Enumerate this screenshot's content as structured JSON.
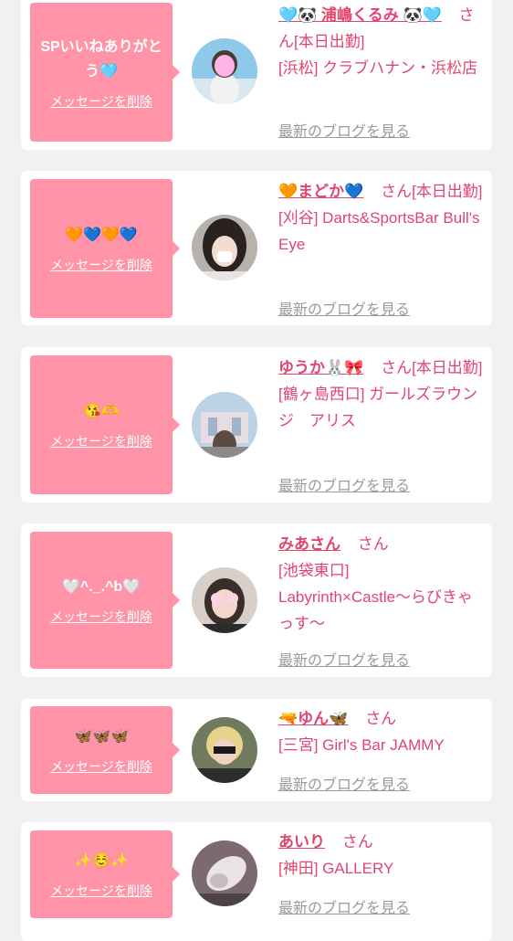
{
  "messages": [
    {
      "message": "SPいいねありがとう🩵",
      "delete_label": "メッセージを削除",
      "name": "🩵🐼 浦嶋くるみ 🐼🩵",
      "san": "さん",
      "status": "[本日出勤]",
      "shop": "[浜松] クラブハナン・浜松店",
      "blog_label": "最新のブログを見る"
    },
    {
      "message": "🧡💙🧡💙",
      "delete_label": "メッセージを削除",
      "name": "🧡まどか💙",
      "san": "さん",
      "status": "[本日出勤]",
      "shop": "[刈谷] Darts&SportsBar Bull's Eye",
      "blog_label": "最新のブログを見る"
    },
    {
      "message": "😘🫶",
      "delete_label": "メッセージを削除",
      "name": "ゆうか🐰🎀",
      "san": "さん",
      "status": "[本日出勤]",
      "shop": "[鶴ヶ島西口] ガールズラウンジ　アリス",
      "blog_label": "最新のブログを見る"
    },
    {
      "message": "🤍^._.^b🤍",
      "delete_label": "メッセージを削除",
      "name": "みあさん",
      "san": "さん",
      "status": "",
      "shop": "[池袋東口] Labyrinth×Castle〜らびきゃっす〜",
      "blog_label": "最新のブログを見る"
    },
    {
      "message": "🦋🦋🦋",
      "delete_label": "メッセージを削除",
      "name": "🔫ゆん🦋",
      "san": "さん",
      "status": "",
      "shop": "[三宮] Girl's Bar JAMMY",
      "blog_label": "最新のブログを見る"
    },
    {
      "message": "✨☺️✨",
      "delete_label": "メッセージを削除",
      "name": "あいり",
      "san": "さん",
      "status": "",
      "shop": "[神田] GALLERY",
      "blog_label": "最新のブログを見る"
    }
  ],
  "colors": {
    "background": "#f1f1f3",
    "card": "#ffffff",
    "bubble": "#ff94a9",
    "accent_text": "#e0456f",
    "link_gray": "#9a9a9a"
  }
}
